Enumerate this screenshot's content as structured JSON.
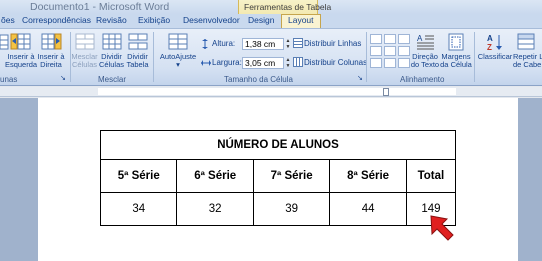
{
  "window": {
    "title": "Documento1 - Microsoft Word"
  },
  "contextual_group": {
    "label": "Ferramentas de Tabela"
  },
  "tabs": [
    {
      "label": "ões",
      "active": false
    },
    {
      "label": "Correspondências",
      "active": false
    },
    {
      "label": "Revisão",
      "active": false
    },
    {
      "label": "Exibição",
      "active": false
    },
    {
      "label": "Desenvolvedor",
      "active": false
    },
    {
      "label": "Design",
      "active": false
    },
    {
      "label": "Layout",
      "active": true
    }
  ],
  "ribbon": {
    "groups": {
      "linhas": "unas",
      "mesclar": "Mesclar",
      "tamanho": "Tamanho da Célula",
      "alinhamento": "Alinhamento"
    },
    "buttons": {
      "inserir_esquerda": [
        "Inserir à",
        "Esquerda"
      ],
      "inserir_direita": [
        "Inserir à",
        "Direita"
      ],
      "mesclar_celulas": [
        "Mesclar",
        "Células"
      ],
      "dividir_celulas": [
        "Dividir",
        "Células"
      ],
      "dividir_tabela": [
        "Dividir",
        "Tabela"
      ],
      "autoajuste": "AutoAjuste",
      "altura_label": "Altura:",
      "altura_value": "1,38 cm",
      "largura_label": "Largura:",
      "largura_value": "3,05 cm",
      "distribuir_linhas": "Distribuir Linhas",
      "distribuir_colunas": "Distribuir Colunas",
      "direcao_texto": [
        "Direção",
        "do Texto"
      ],
      "margens_celula": [
        "Margens",
        "da Célula"
      ],
      "classificar": "Classificar",
      "repetir_linhas": [
        "Repetir Li",
        "de Cabe"
      ]
    }
  },
  "table": {
    "title": "NÚMERO DE ALUNOS",
    "headers": [
      "5ª Série",
      "6ª Série",
      "7ª Série",
      "8ª Série",
      "Total"
    ],
    "values": [
      "34",
      "32",
      "39",
      "44",
      "149"
    ]
  },
  "colors": {
    "ribbon_text": "#15428b",
    "active_tab": "#f9f3d2",
    "contextual_group": "#efe19a",
    "doc_background": "#a0b2cc",
    "arrow": "#e02020"
  }
}
